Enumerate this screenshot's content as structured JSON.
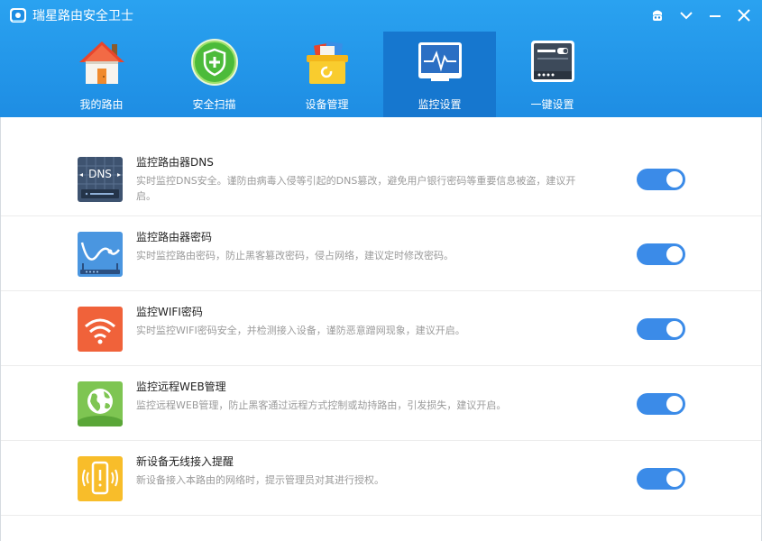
{
  "app": {
    "title": "瑞星路由安全卫士",
    "header_gradient_top": "#2aa2f0",
    "header_gradient_bottom": "#1e8de3",
    "active_tab_color": "#1677cf"
  },
  "window_controls": [
    {
      "name": "skin-icon"
    },
    {
      "name": "menu-chevron-icon"
    },
    {
      "name": "minimize-icon"
    },
    {
      "name": "close-icon"
    }
  ],
  "nav": {
    "tabs": [
      {
        "label": "我的路由",
        "icon": "house-icon",
        "active": false
      },
      {
        "label": "安全扫描",
        "icon": "shield-plus-icon",
        "active": false
      },
      {
        "label": "设备管理",
        "icon": "toolbox-icon",
        "active": false
      },
      {
        "label": "监控设置",
        "icon": "monitor-pulse-icon",
        "active": true
      },
      {
        "label": "一键设置",
        "icon": "router-settings-icon",
        "active": false
      }
    ]
  },
  "monitors": [
    {
      "title": "监控路由器DNS",
      "desc": "实时监控DNS安全。谨防由病毒入侵等引起的DNS篡改，避免用户银行密码等重要信息被盗，建议开启。",
      "icon": "dns-router-icon",
      "enabled": true
    },
    {
      "title": "监控路由器密码",
      "desc": "实时监控路由密码，防止黑客篡改密码，侵占网络，建议定时修改密码。",
      "icon": "router-password-icon",
      "enabled": true
    },
    {
      "title": "监控WIFI密码",
      "desc": "实时监控WIFI密码安全，并检测接入设备，谨防恶意蹭网现象，建议开启。",
      "icon": "wifi-icon",
      "enabled": true
    },
    {
      "title": "监控远程WEB管理",
      "desc": "监控远程WEB管理，防止黑客通过远程方式控制或劫持路由，引发损失，建议开启。",
      "icon": "globe-icon",
      "enabled": true
    },
    {
      "title": "新设备无线接入提醒",
      "desc": "新设备接入本路由的网络时，提示管理员对其进行授权。",
      "icon": "phone-alert-icon",
      "enabled": true
    }
  ],
  "toggle_color": "#3b8be8"
}
